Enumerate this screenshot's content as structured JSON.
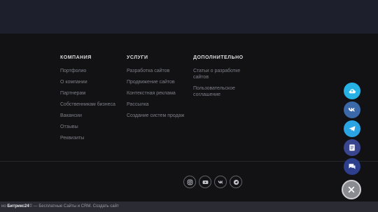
{
  "footer": {
    "columns": [
      {
        "title": "КОМПАНИЯ",
        "links": [
          "Портфолио",
          "О компании",
          "Партнерам",
          "Собственникам бизнеса",
          "Вакансии",
          "Отзывы",
          "Реквизиты"
        ]
      },
      {
        "title": "УСЛУГИ",
        "links": [
          "Разработка сайтов",
          "Продвижение сайтов",
          "Контекстная реклама",
          "Рассылка",
          "Создание систем продаж"
        ]
      },
      {
        "title": "ДОПОЛНИТЕЛЬНО",
        "links": [
          "Статьи о разработке сайтов",
          "Пользовательское соглашение"
        ]
      }
    ],
    "socials": [
      "instagram-icon",
      "youtube-icon",
      "vk-icon",
      "telegram-icon"
    ]
  },
  "widget": {
    "buttons": [
      "cloud-icon",
      "vk-icon",
      "telegram-icon",
      "form-icon",
      "chat-icon"
    ],
    "close": "close-icon"
  },
  "bottom_bar": {
    "prefix": "но ",
    "brand": "Битрикс24",
    "suffix": "© — Бесплатные Сайты и CRM. Создать сайт"
  },
  "colors": {
    "top_band": "#1e1f2c",
    "footer_bg": "#121215",
    "cloud": "#27b2e6",
    "vk": "#3a68a8",
    "telegram": "#2aa4e2",
    "form": "#3a4590",
    "chat": "#2d3f8c"
  }
}
